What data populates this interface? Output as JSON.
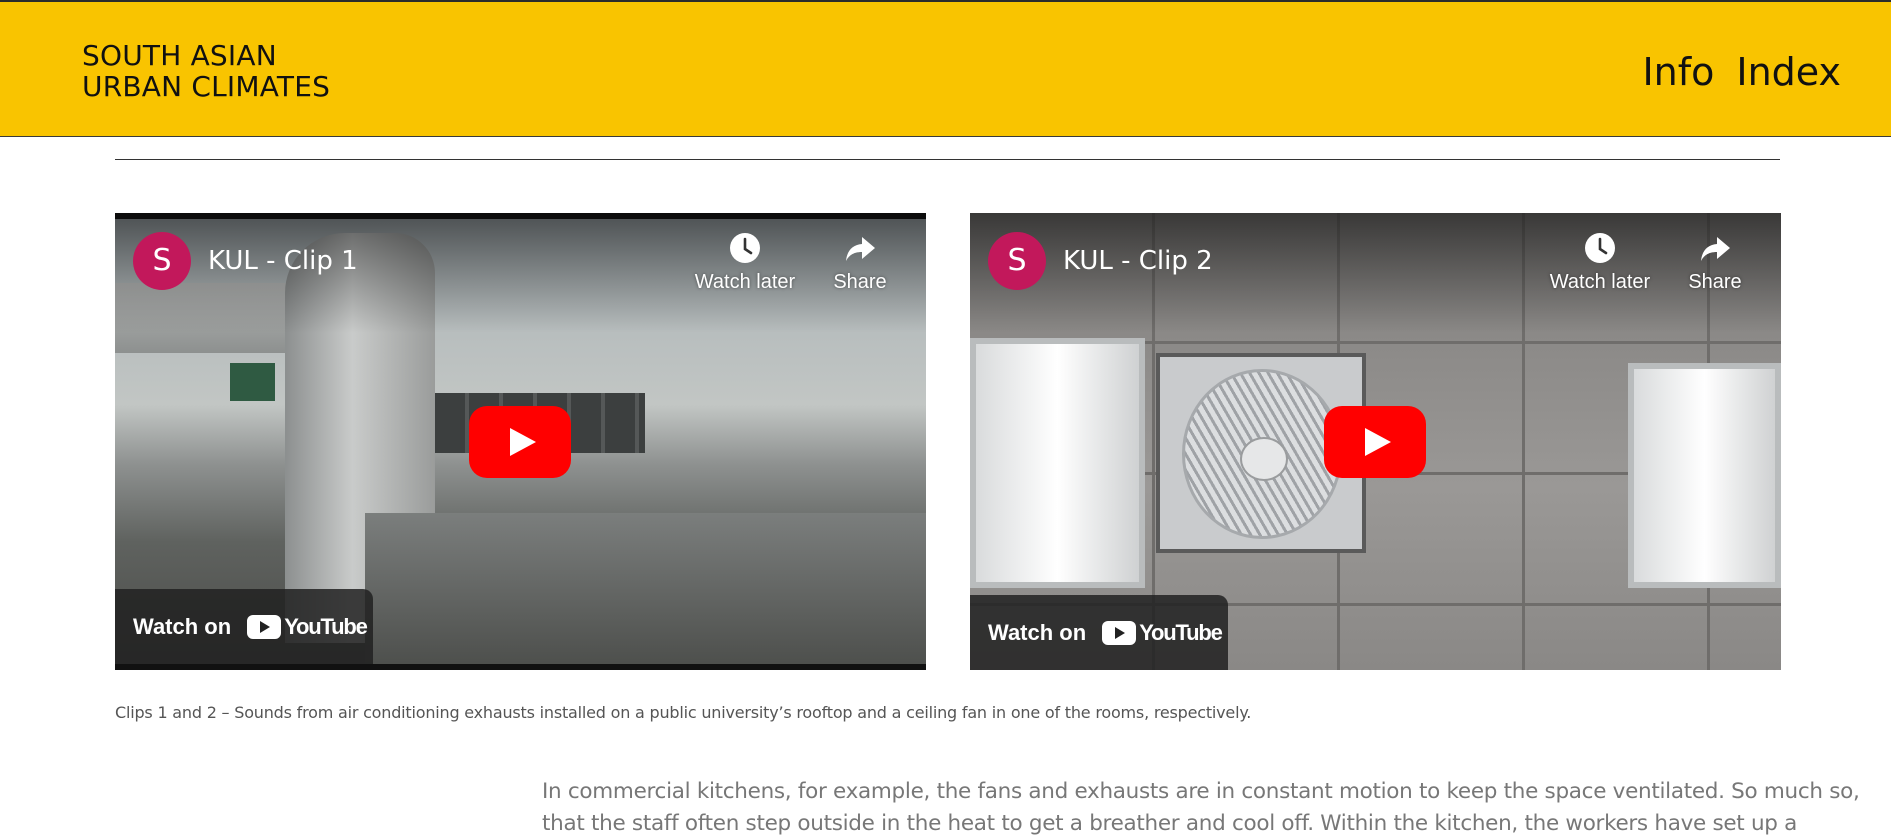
{
  "header": {
    "title_line1": "SOUTH ASIAN",
    "title_line2": "URBAN CLIMATES",
    "nav": [
      {
        "label": "Info"
      },
      {
        "label": "Index"
      }
    ],
    "background_color": "#f9c400"
  },
  "videos": [
    {
      "channel_initial": "S",
      "title": "KUL - Clip 1",
      "watch_later_label": "Watch later",
      "share_label": "Share",
      "watch_on_label": "Watch on",
      "youtube_label": "YouTube"
    },
    {
      "channel_initial": "S",
      "title": "KUL - Clip 2",
      "watch_later_label": "Watch later",
      "share_label": "Share",
      "watch_on_label": "Watch on",
      "youtube_label": "YouTube"
    }
  ],
  "caption": "Clips 1 and 2 – Sounds from air conditioning exhausts installed on a public university’s rooftop and a ceiling fan in one of the rooms, respectively.",
  "body": {
    "line1": "In commercial kitchens, for example, the fans and exhausts are in constant motion to keep the space ventilated. So much so,",
    "line2": "that the staff often step outside in the heat to get a breather and cool off. Within the kitchen, the workers have set up a"
  },
  "colors": {
    "accent": "#f9c400",
    "youtube_red": "#ff0000",
    "avatar": "#c2185b"
  }
}
